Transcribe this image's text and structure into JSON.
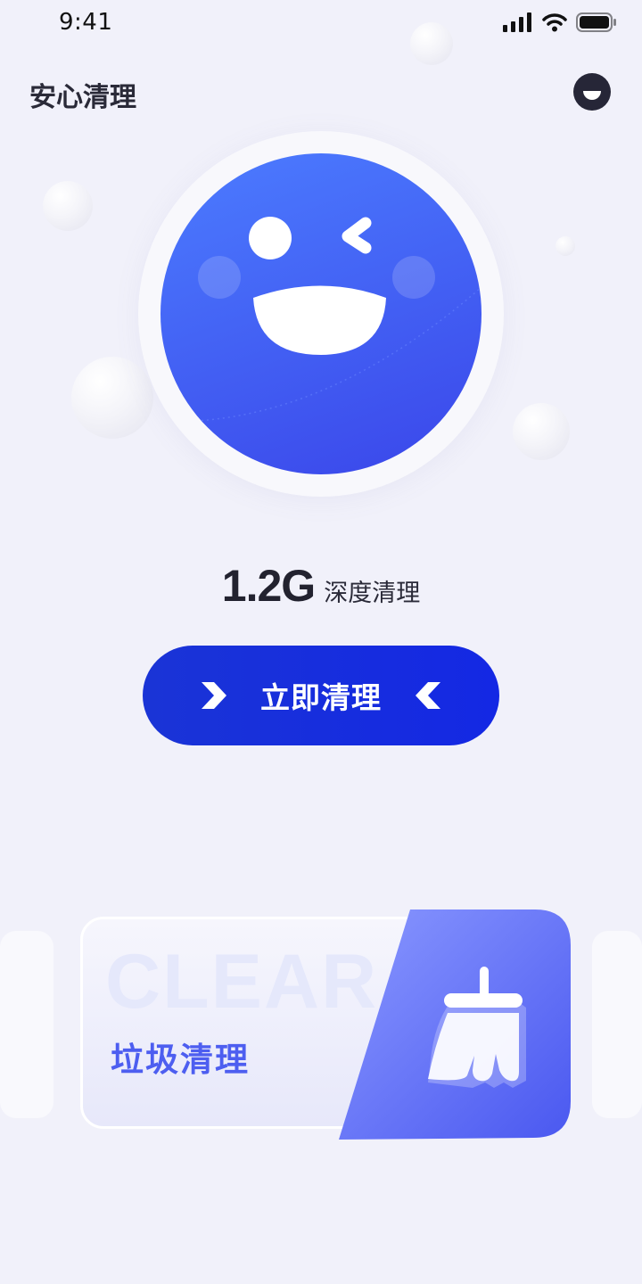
{
  "status_bar": {
    "time": "9:41"
  },
  "header": {
    "title": "安心清理"
  },
  "hero": {
    "size": "1.2G",
    "label": "深度清理"
  },
  "clean_button": {
    "label": "立即清理"
  },
  "card": {
    "watermark": "CLEAR",
    "title": "垃圾清理",
    "icon": "broom-icon"
  },
  "colors": {
    "accent": "#1a34d6",
    "face": "#4464f5",
    "card_text": "#4d5ef0"
  }
}
